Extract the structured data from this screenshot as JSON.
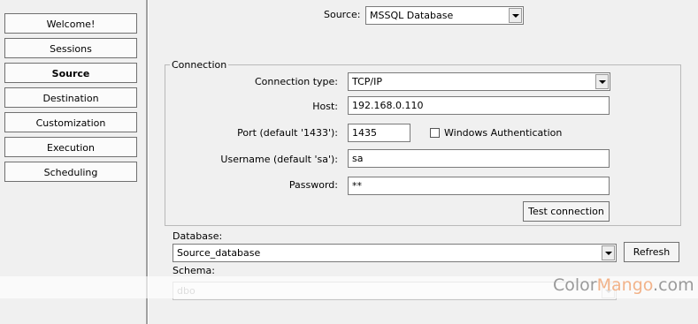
{
  "nav": {
    "items": [
      {
        "label": "Welcome!"
      },
      {
        "label": "Sessions"
      },
      {
        "label": "Source"
      },
      {
        "label": "Destination"
      },
      {
        "label": "Customization"
      },
      {
        "label": "Execution"
      },
      {
        "label": "Scheduling"
      }
    ],
    "active": "Source"
  },
  "source": {
    "label": "Source:",
    "value": "MSSQL Database"
  },
  "connection": {
    "group_label": "Connection",
    "type_label": "Connection type:",
    "type_value": "TCP/IP",
    "host_label": "Host:",
    "host_value": "192.168.0.110",
    "port_label": "Port (default '1433'):",
    "port_value": "1435",
    "windows_auth_label": "Windows Authentication",
    "windows_auth_checked": false,
    "username_label": "Username (default 'sa'):",
    "username_value": "sa",
    "password_label": "Password:",
    "password_value": "**",
    "test_button": "Test connection"
  },
  "database": {
    "label": "Database:",
    "value": "Source_database",
    "refresh_button": "Refresh"
  },
  "schema": {
    "label": "Schema:",
    "value": "dbo"
  },
  "watermark": {
    "part1": "Color",
    "part2": "Mango",
    "part3": ".com"
  }
}
